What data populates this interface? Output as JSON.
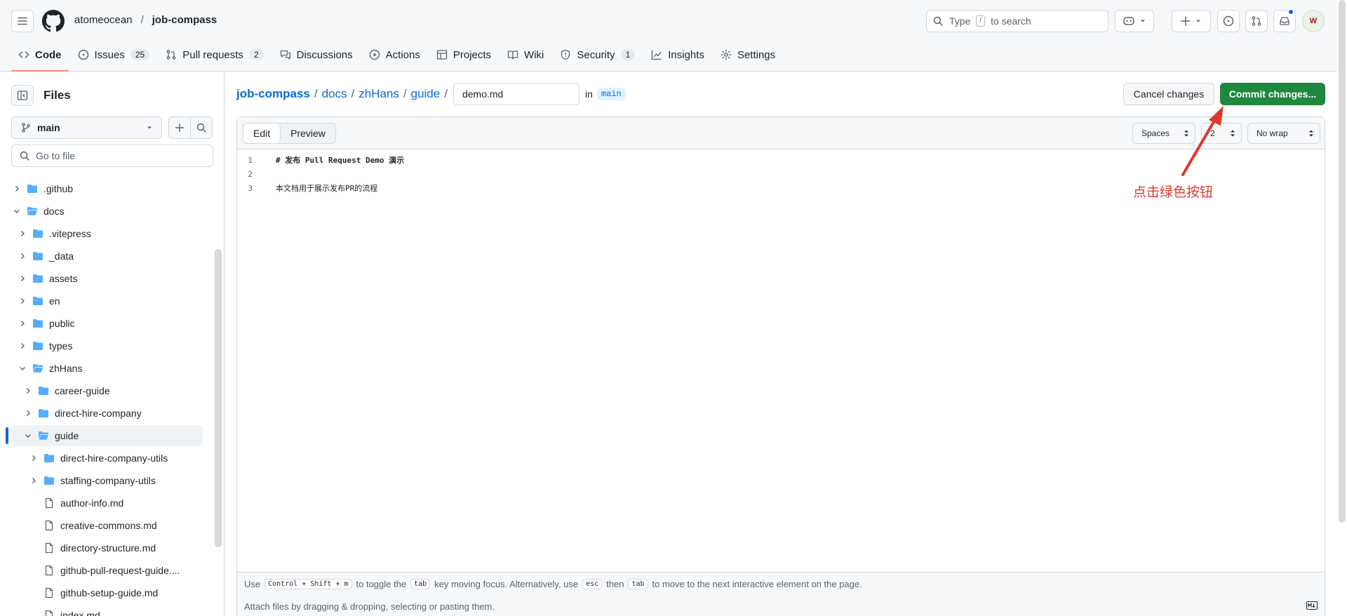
{
  "header": {
    "owner": "atomeocean",
    "repo": "job-compass",
    "search_type": "Type",
    "search_key": "/",
    "search_rest": "to search",
    "avatar_text": "W"
  },
  "repo_nav": [
    {
      "label": "Code",
      "icon": "code-icon",
      "active": true
    },
    {
      "label": "Issues",
      "icon": "issue-icon",
      "count": "25"
    },
    {
      "label": "Pull requests",
      "icon": "pull-request-icon",
      "count": "2"
    },
    {
      "label": "Discussions",
      "icon": "discussions-icon"
    },
    {
      "label": "Actions",
      "icon": "play-icon"
    },
    {
      "label": "Projects",
      "icon": "table-icon"
    },
    {
      "label": "Wiki",
      "icon": "book-icon"
    },
    {
      "label": "Security",
      "icon": "shield-icon",
      "count": "1"
    },
    {
      "label": "Insights",
      "icon": "graph-icon"
    },
    {
      "label": "Settings",
      "icon": "gear-icon"
    }
  ],
  "sidebar": {
    "title": "Files",
    "branch": "main",
    "goto_placeholder": "Go to file",
    "tree": [
      {
        "label": ".github",
        "type": "folder",
        "depth": 0,
        "open": false
      },
      {
        "label": "docs",
        "type": "folder",
        "depth": 0,
        "open": true
      },
      {
        "label": ".vitepress",
        "type": "folder",
        "depth": 1,
        "open": false
      },
      {
        "label": "_data",
        "type": "folder",
        "depth": 1,
        "open": false
      },
      {
        "label": "assets",
        "type": "folder",
        "depth": 1,
        "open": false
      },
      {
        "label": "en",
        "type": "folder",
        "depth": 1,
        "open": false
      },
      {
        "label": "public",
        "type": "folder",
        "depth": 1,
        "open": false
      },
      {
        "label": "types",
        "type": "folder",
        "depth": 1,
        "open": false
      },
      {
        "label": "zhHans",
        "type": "folder",
        "depth": 1,
        "open": true
      },
      {
        "label": "career-guide",
        "type": "folder",
        "depth": 2,
        "open": false
      },
      {
        "label": "direct-hire-company",
        "type": "folder",
        "depth": 2,
        "open": false
      },
      {
        "label": "guide",
        "type": "folder",
        "depth": 2,
        "open": true,
        "selected": true
      },
      {
        "label": "direct-hire-company-utils",
        "type": "folder",
        "depth": 3,
        "open": false
      },
      {
        "label": "staffing-company-utils",
        "type": "folder",
        "depth": 3,
        "open": false
      },
      {
        "label": "author-info.md",
        "type": "file",
        "depth": 3
      },
      {
        "label": "creative-commons.md",
        "type": "file",
        "depth": 3
      },
      {
        "label": "directory-structure.md",
        "type": "file",
        "depth": 3
      },
      {
        "label": "github-pull-request-guide....",
        "type": "file",
        "depth": 3
      },
      {
        "label": "github-setup-guide.md",
        "type": "file",
        "depth": 3
      },
      {
        "label": "index.md",
        "type": "file",
        "depth": 3
      }
    ]
  },
  "path": {
    "repo": "job-compass",
    "segments": [
      "docs",
      "zhHans",
      "guide"
    ],
    "filename": "demo.md",
    "in_label": "in",
    "branch": "main"
  },
  "actions": {
    "cancel": "Cancel changes",
    "commit": "Commit changes..."
  },
  "editor": {
    "tab_edit": "Edit",
    "tab_preview": "Preview",
    "indent_mode": "Spaces",
    "indent_size": "2",
    "wrap_mode": "No wrap",
    "lines": [
      {
        "num": "1",
        "text": "# 发布 Pull Request Demo 演示",
        "bold": true
      },
      {
        "num": "2",
        "text": "",
        "bold": false
      },
      {
        "num": "3",
        "text": "本文档用于展示发布PR的流程",
        "bold": false
      }
    ],
    "hint": {
      "use": "Use",
      "keys": "Control + Shift + m",
      "toggle": "to toggle the",
      "tab_key": "tab",
      "moving": "key moving focus. Alternatively, use",
      "esc_key": "esc",
      "then": "then",
      "tab_key2": "tab",
      "rest": "to move to the next interactive element on the page."
    },
    "attach": "Attach files by dragging & dropping, selecting or pasting them."
  },
  "annotation": {
    "text": "点击绿色按钮",
    "color": "#e0382b"
  },
  "colors": {
    "primary_green": "#1f883d",
    "link_blue": "#0969da",
    "active_tab_underline": "#fd8c73"
  }
}
